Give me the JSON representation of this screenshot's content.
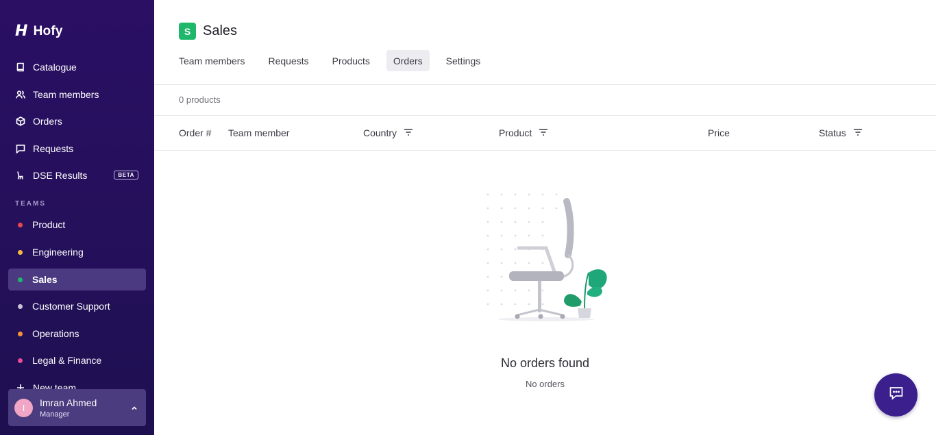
{
  "app": {
    "name": "Hofy"
  },
  "sidebar": {
    "nav": [
      {
        "label": "Catalogue",
        "icon": "book-icon"
      },
      {
        "label": "Team members",
        "icon": "users-icon"
      },
      {
        "label": "Orders",
        "icon": "box-icon"
      },
      {
        "label": "Requests",
        "icon": "message-icon"
      },
      {
        "label": "DSE Results",
        "icon": "chair-icon",
        "badge": "BETA"
      }
    ],
    "teams_label": "TEAMS",
    "teams": [
      {
        "label": "Product",
        "color": "#e5484d"
      },
      {
        "label": "Engineering",
        "color": "#f5b942"
      },
      {
        "label": "Sales",
        "color": "#1fb86a",
        "active": true
      },
      {
        "label": "Customer Support",
        "color": "#c9c5d8"
      },
      {
        "label": "Operations",
        "color": "#f5923e"
      },
      {
        "label": "Legal & Finance",
        "color": "#ea4c9a"
      }
    ],
    "new_team": "New team",
    "user": {
      "initial": "I",
      "name": "Imran Ahmed",
      "role": "Manager"
    }
  },
  "header": {
    "badge": "S",
    "title": "Sales",
    "tabs": [
      "Team members",
      "Requests",
      "Products",
      "Orders",
      "Settings"
    ],
    "active_tab": "Orders"
  },
  "table": {
    "count": "0 products",
    "columns": [
      "Order #",
      "Team member",
      "Country",
      "Product",
      "Price",
      "Status"
    ]
  },
  "empty_state": {
    "title": "No orders found",
    "subtitle": "No orders"
  },
  "colors": {
    "sidebar_bg": "#2a0f63",
    "accent": "#3b1f8c",
    "sales": "#1fb86a"
  }
}
